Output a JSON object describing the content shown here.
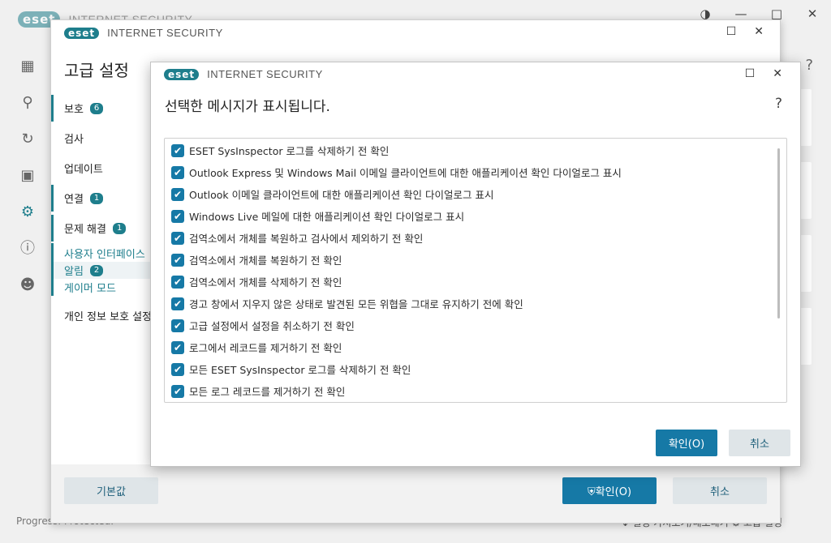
{
  "brand": {
    "badge": "eset",
    "product": "INTERNET SECURITY"
  },
  "main_window": {
    "status": "Progress. Protected.",
    "bottom_links": "↓ 설정 가져오기/내보내기  ⚙ 고급 설정",
    "help": "?",
    "controls": [
      "◑",
      "—",
      "□",
      "✕"
    ],
    "side_icons": [
      "overview-icon",
      "scan-icon",
      "update-icon",
      "tools-icon",
      "setup-icon",
      "help-icon",
      "account-icon"
    ]
  },
  "advanced_setup": {
    "title": "고급 설정",
    "nav": [
      {
        "label": "보호",
        "badge": "6"
      },
      {
        "label": "검사",
        "badge": ""
      },
      {
        "label": "업데이트",
        "badge": ""
      },
      {
        "label": "연결",
        "badge": "1"
      },
      {
        "label": "문제 해결",
        "badge": "1"
      }
    ],
    "ui_group": {
      "label": "사용자 인터페이스",
      "items": [
        {
          "label": "알림",
          "badge": "2"
        },
        {
          "label": "게이머 모드",
          "badge": ""
        }
      ]
    },
    "privacy": "개인 정보 보호 설정",
    "default_button": "기본값",
    "ok_button": "⛨확인(O)",
    "cancel_button": "취소"
  },
  "dialog": {
    "heading": "선택한 메시지가 표시됩니다.",
    "help": "?",
    "items": [
      {
        "label": "ESET SysInspector 로그를 삭제하기 전 확인",
        "checked": true
      },
      {
        "label": "Outlook Express 및 Windows Mail 이메일 클라이언트에 대한 애플리케이션 확인 다이얼로그 표시",
        "checked": true
      },
      {
        "label": "Outlook 이메일 클라이언트에 대한 애플리케이션 확인 다이얼로그 표시",
        "checked": true
      },
      {
        "label": "Windows Live 메일에 대한 애플리케이션 확인 다이얼로그 표시",
        "checked": true
      },
      {
        "label": "검역소에서 개체를 복원하고 검사에서 제외하기 전 확인",
        "checked": true
      },
      {
        "label": "검역소에서 개체를 복원하기 전 확인",
        "checked": true
      },
      {
        "label": "검역소에서 개체를 삭제하기 전 확인",
        "checked": true
      },
      {
        "label": "경고 창에서 지우지 않은 상태로 발견된 모든 위협을 그대로 유지하기 전에 확인",
        "checked": true
      },
      {
        "label": "고급 설정에서 설정을 취소하기 전 확인",
        "checked": true
      },
      {
        "label": "로그에서 레코드를 제거하기 전 확인",
        "checked": true
      },
      {
        "label": "모든 ESET SysInspector 로그를 삭제하기 전 확인",
        "checked": true
      },
      {
        "label": "모든 로그 레코드를 제거하기 전 확인",
        "checked": true
      }
    ],
    "ok_button": "확인(O)",
    "cancel_button": "취소"
  }
}
